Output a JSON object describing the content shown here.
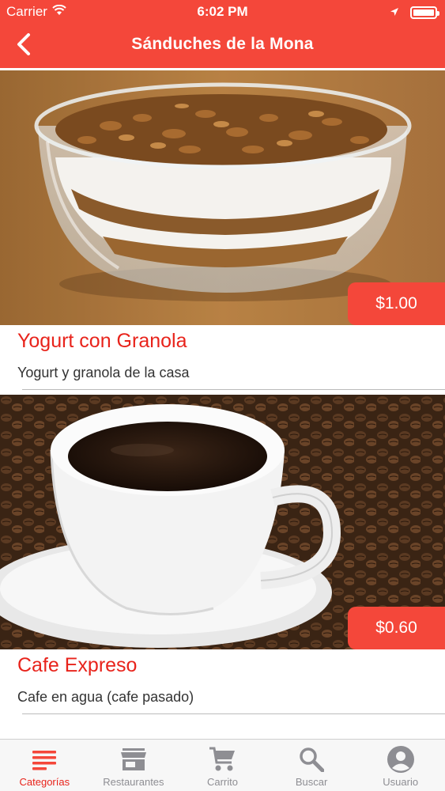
{
  "status_bar": {
    "carrier": "Carrier",
    "time": "6:02 PM"
  },
  "nav": {
    "title": "Sánduches de la Mona",
    "back_icon": "chevron-left-icon"
  },
  "products": [
    {
      "name": "Yogurt con Granola",
      "description": "Yogurt y granola de la casa",
      "price": "$1.00",
      "image": "yogurt-granola-photo"
    },
    {
      "name": "Cafe Expreso",
      "description": "Cafe en agua (cafe pasado)",
      "price": "$0.60",
      "image": "coffee-cup-photo"
    }
  ],
  "tabs": [
    {
      "label": "Categorías",
      "icon": "list-icon",
      "active": true
    },
    {
      "label": "Restaurantes",
      "icon": "store-icon",
      "active": false
    },
    {
      "label": "Carrito",
      "icon": "cart-icon",
      "active": false
    },
    {
      "label": "Buscar",
      "icon": "search-icon",
      "active": false
    },
    {
      "label": "Usuario",
      "icon": "user-icon",
      "active": false
    }
  ],
  "colors": {
    "accent": "#f4473a",
    "title_red": "#e8231b",
    "tab_inactive": "#8e8e93"
  }
}
